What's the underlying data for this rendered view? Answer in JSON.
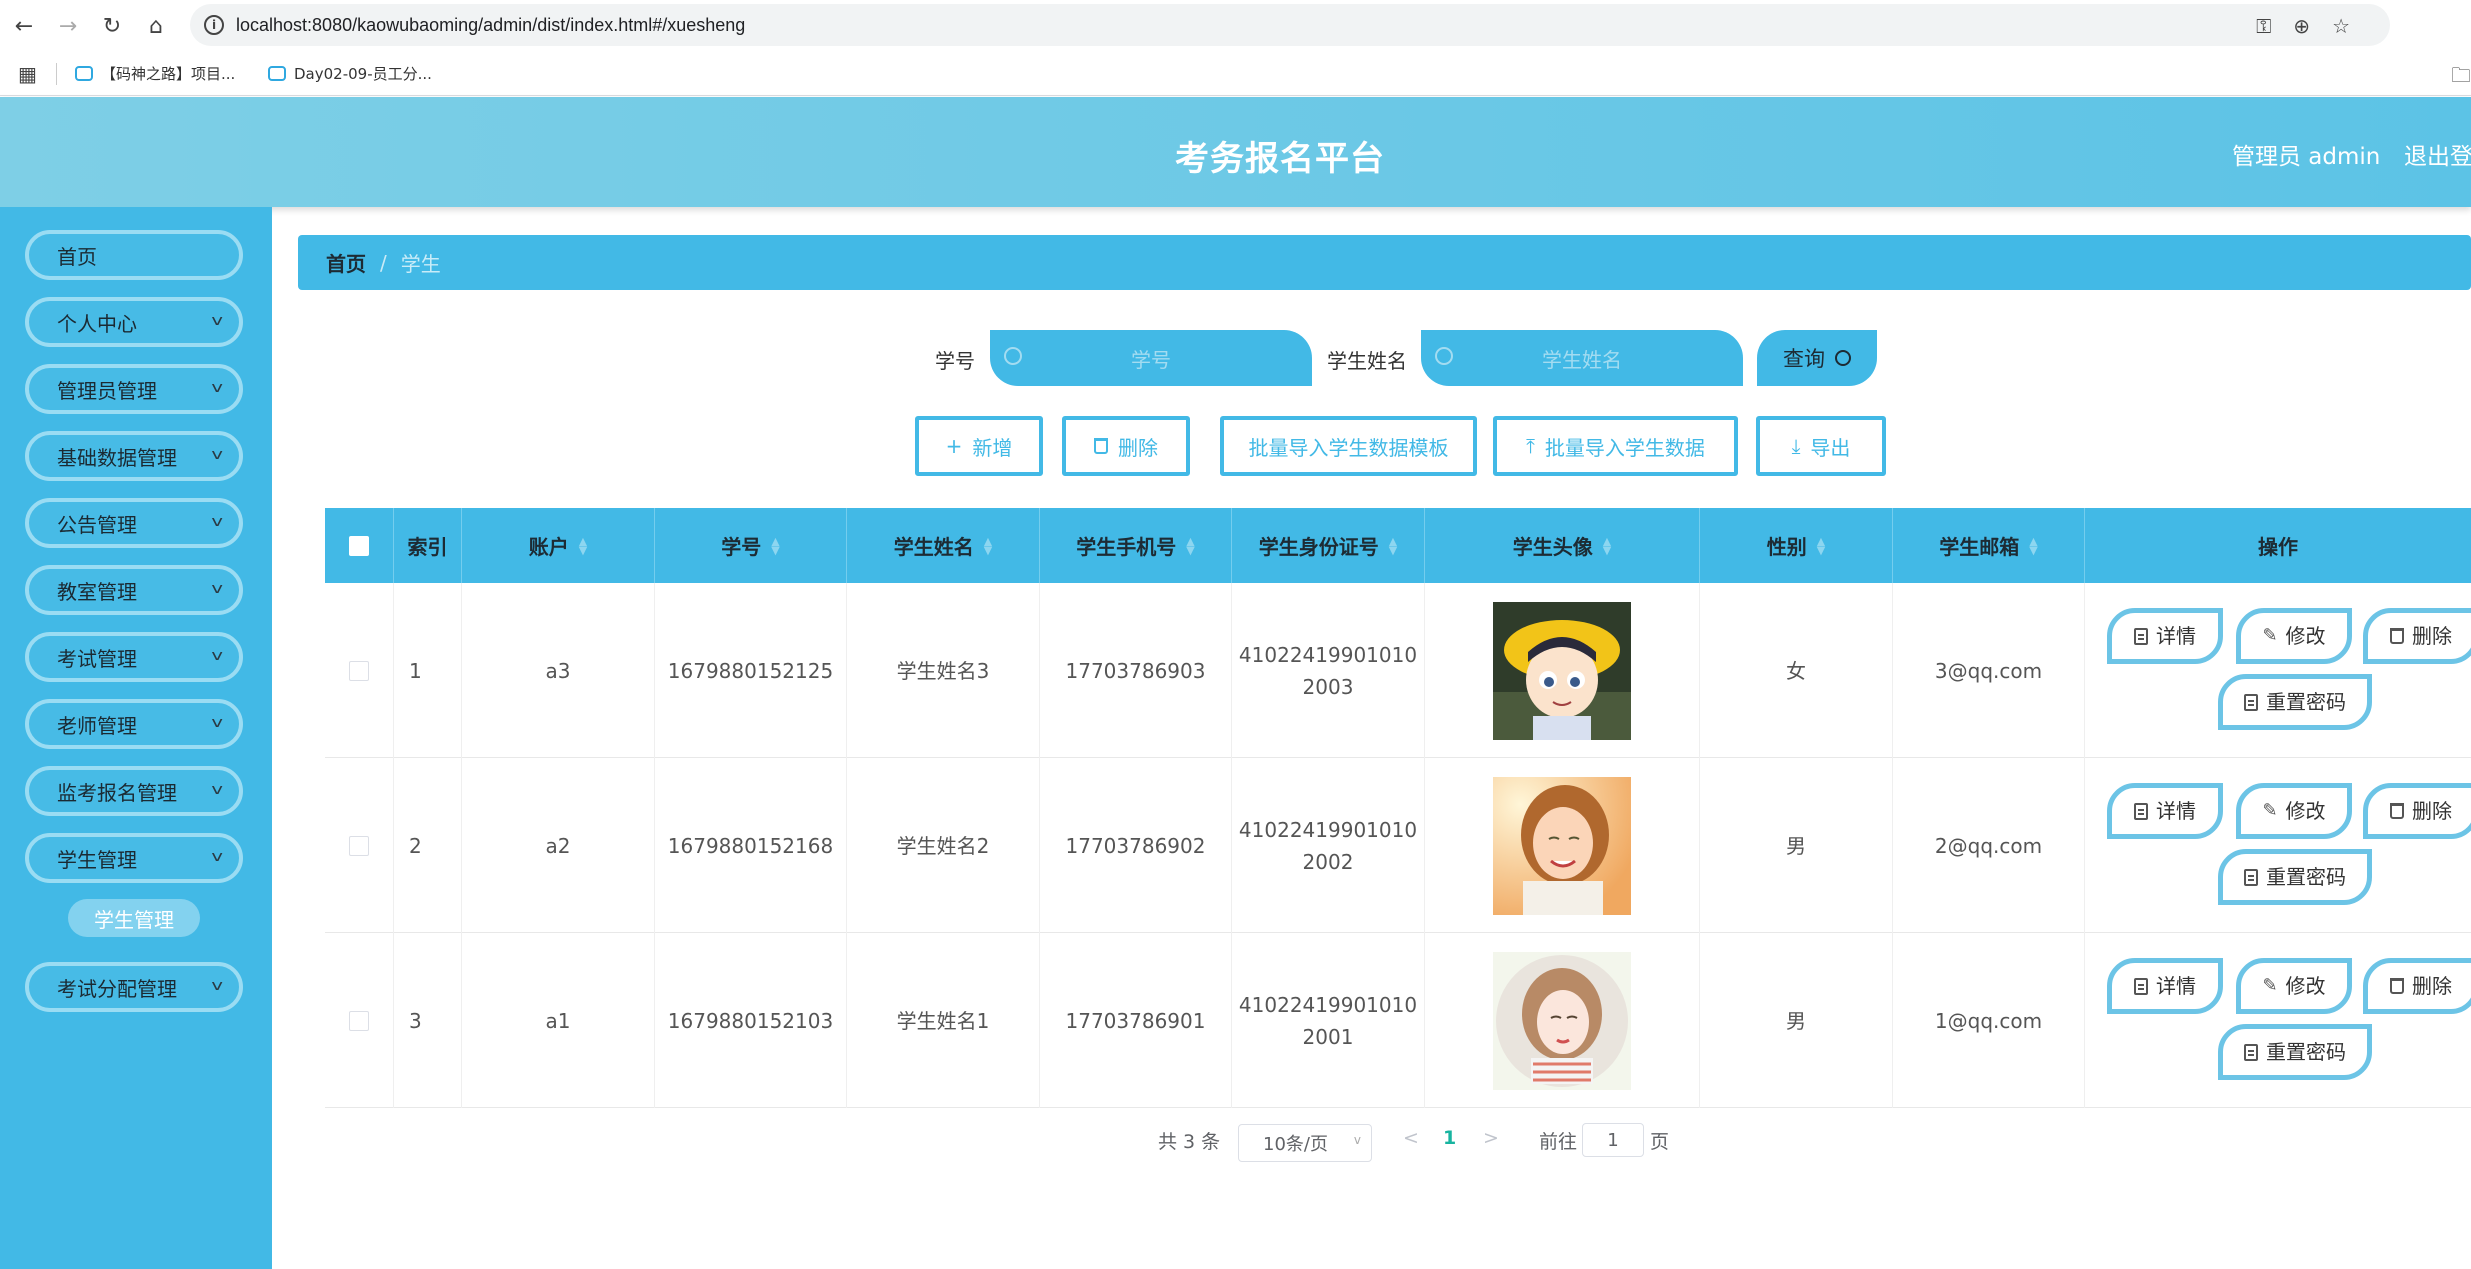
{
  "browser": {
    "url": "localhost:8080/kaowubaoming/admin/dist/index.html#/xuesheng",
    "bookmarks": [
      "【码神之路】项目...",
      "Day02-09-员工分..."
    ]
  },
  "header": {
    "title": "考务报名平台",
    "user": "管理员 admin",
    "logout": "退出登"
  },
  "sidebar": {
    "items": [
      {
        "label": "首页"
      },
      {
        "label": "个人中心"
      },
      {
        "label": "管理员管理"
      },
      {
        "label": "基础数据管理"
      },
      {
        "label": "公告管理"
      },
      {
        "label": "教室管理"
      },
      {
        "label": "考试管理"
      },
      {
        "label": "老师管理"
      },
      {
        "label": "监考报名管理"
      },
      {
        "label": "学生管理"
      },
      {
        "label": "考试分配管理"
      }
    ],
    "active_sub": "学生管理"
  },
  "breadcrumb": {
    "home": "首页",
    "separator": "/",
    "current": "学生"
  },
  "search": {
    "student_no_label": "学号",
    "student_no_placeholder": "学号",
    "student_name_label": "学生姓名",
    "student_name_placeholder": "学生姓名",
    "query_label": "查询"
  },
  "actions": {
    "add": "新增",
    "delete": "删除",
    "import_template": "批量导入学生数据模板",
    "import_data": "批量导入学生数据",
    "export": "导出"
  },
  "table": {
    "headers": {
      "index": "索引",
      "account": "账户",
      "student_no": "学号",
      "name": "学生姓名",
      "phone": "学生手机号",
      "id_card": "学生身份证号",
      "avatar": "学生头像",
      "gender": "性别",
      "email": "学生邮箱",
      "ops": "操作"
    },
    "rows": [
      {
        "index": "1",
        "account": "a3",
        "student_no": "1679880152125",
        "name": "学生姓名3",
        "phone": "17703786903",
        "id_card_1": "41022419901010",
        "id_card_2": "2003",
        "avatar": "avatar-boy-hat",
        "gender": "女",
        "email": "3@qq.com"
      },
      {
        "index": "2",
        "account": "a2",
        "student_no": "1679880152168",
        "name": "学生姓名2",
        "phone": "17703786902",
        "id_card_1": "41022419901010",
        "id_card_2": "2002",
        "avatar": "avatar-girl-smile",
        "gender": "男",
        "email": "2@qq.com"
      },
      {
        "index": "3",
        "account": "a1",
        "student_no": "1679880152103",
        "name": "学生姓名1",
        "phone": "17703786901",
        "id_card_1": "41022419901010",
        "id_card_2": "2001",
        "avatar": "avatar-girl-drawn",
        "gender": "男",
        "email": "1@qq.com"
      }
    ],
    "row_ops": {
      "detail": "详情",
      "edit": "修改",
      "delete": "删除",
      "reset": "重置密码"
    }
  },
  "pagination": {
    "total": "共 3 条",
    "page_size": "10条/页",
    "prev": "<",
    "current": "1",
    "next": ">",
    "goto_label": "前往",
    "goto_value": "1",
    "page_suffix": "页"
  },
  "colors": {
    "primary": "#42b9e6",
    "header": "#6ccbe6",
    "border_accent": "#6cc4e6",
    "active_page": "#18b4a0"
  }
}
